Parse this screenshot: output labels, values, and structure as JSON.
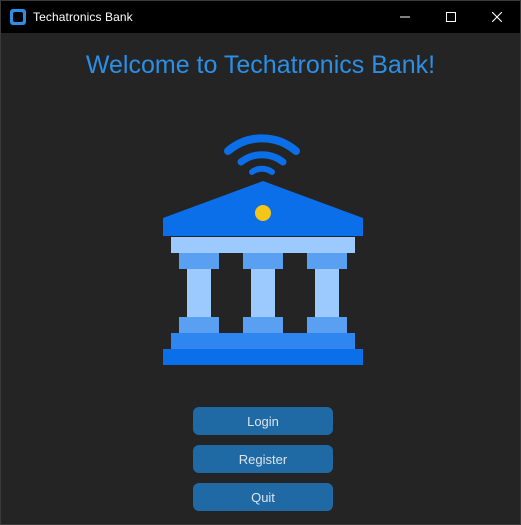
{
  "window": {
    "title": "Techatronics Bank",
    "controls": [
      "minimize",
      "maximize",
      "close"
    ]
  },
  "main": {
    "welcome": "Welcome to Techatronics Bank!",
    "logo_icon": "bank-building-wifi-icon"
  },
  "buttons": {
    "login": "Login",
    "register": "Register",
    "quit": "Quit"
  },
  "colors": {
    "accent": "#2b8fe6",
    "button_bg": "#1f6aa5",
    "background": "#242424",
    "titlebar": "#000000",
    "logo_dark_blue": "#0a6fe8",
    "logo_light_blue": "#9ccaff",
    "logo_coin": "#f5c518"
  }
}
